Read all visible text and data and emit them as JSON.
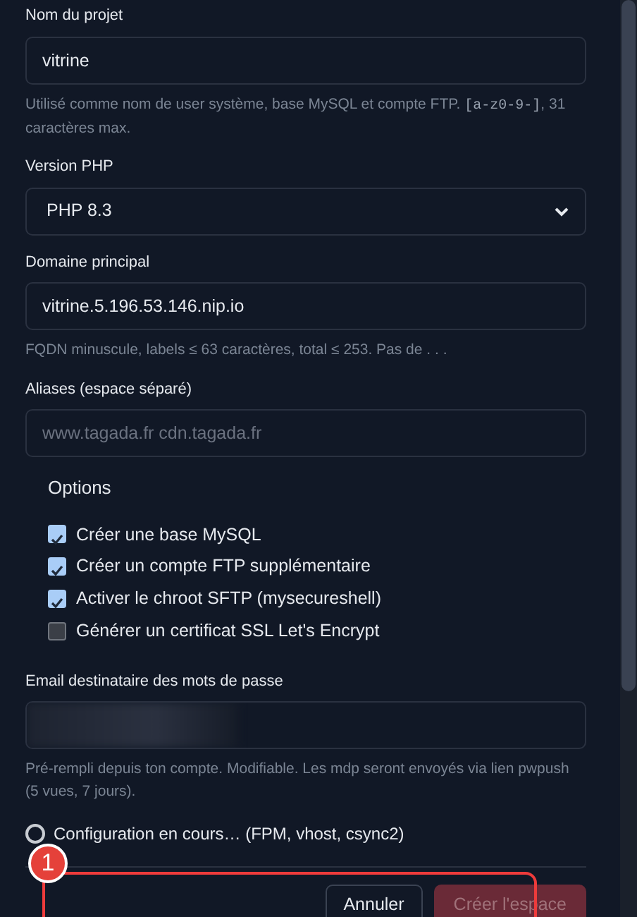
{
  "fields": [
    {
      "kind": "text",
      "label": "Nom du projet",
      "value": "vitrine",
      "help": "Utilisé comme nom de user système, base MySQL et compte FTP. [a-z0-9-], 31 caractères max."
    },
    {
      "kind": "select",
      "label": "Version PHP",
      "value": "PHP 8.3"
    },
    {
      "kind": "text",
      "label": "Domaine principal",
      "value": "vitrine.5.196.53.146.nip.io",
      "help": "FQDN minuscule, labels ≤ 63 caractères, total ≤ 253. Pas de . . ."
    },
    {
      "kind": "text",
      "label": "Aliases (espace séparé)",
      "placeholder": "www.tagada.fr cdn.tagada.fr"
    }
  ],
  "options": {
    "title": "Options",
    "items": [
      {
        "label": "Créer une base MySQL",
        "checked": true
      },
      {
        "label": "Créer un compte FTP supplémentaire",
        "checked": true
      },
      {
        "label": "Activer le chroot SFTP (mysecureshell)",
        "checked": true
      },
      {
        "label": "Générer un certificat SSL Let's Encrypt",
        "checked": false
      }
    ]
  },
  "email": {
    "label": "Email destinataire des mots de passe",
    "redacted": true,
    "help": "Pré-rempli depuis ton compte. Modifiable. Les mdp seront envoyés via lien pwpush (5 vues, 7 jours)."
  },
  "progress": {
    "busy": true,
    "text": "Configuration en cours… (FPM, vhost, csync2)"
  },
  "buttons": [
    {
      "label": "Annuler",
      "kind": "secondary",
      "disabled": false
    },
    {
      "label": "Créer l'espace",
      "kind": "primary",
      "disabled": true
    }
  ],
  "annotation": {
    "number": "1"
  }
}
